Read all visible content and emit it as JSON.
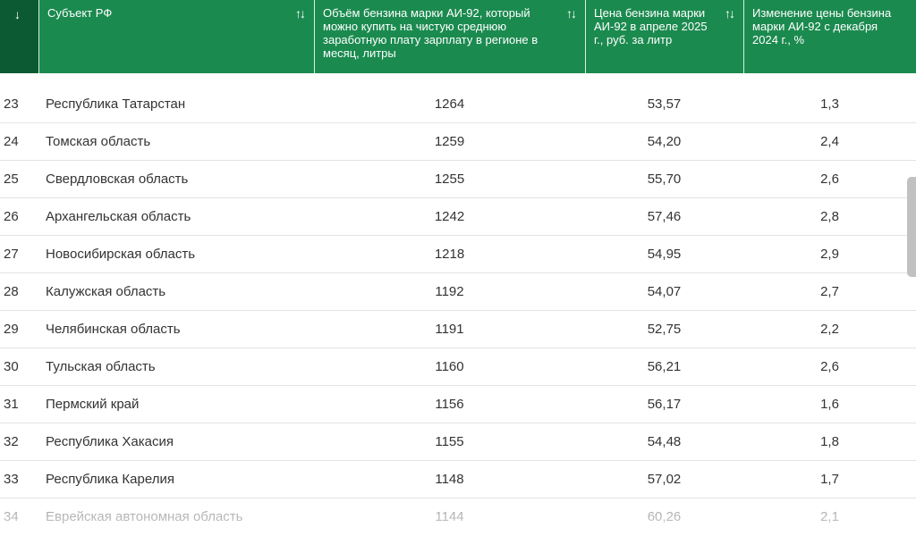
{
  "table": {
    "sort_active_icon": "↓",
    "sort_icon": "↑↓",
    "headers": [
      "Субъект РФ",
      "Объём бензина марки АИ-92, который можно купить на чистую среднюю заработную плату зарплату в регионе в месяц, литры",
      "Цена бензина марки АИ-92 в апреле 2025 г., руб. за литр",
      "Изменение цены бензина марки АИ-92 с декабря 2024 г., %"
    ],
    "rows": [
      {
        "num": "23",
        "name": "Республика Татарстан",
        "volume": "1264",
        "price": "53,57",
        "change": "1,3"
      },
      {
        "num": "24",
        "name": "Томская область",
        "volume": "1259",
        "price": "54,20",
        "change": "2,4"
      },
      {
        "num": "25",
        "name": "Свердловская область",
        "volume": "1255",
        "price": "55,70",
        "change": "2,6"
      },
      {
        "num": "26",
        "name": "Архангельская область",
        "volume": "1242",
        "price": "57,46",
        "change": "2,8"
      },
      {
        "num": "27",
        "name": "Новосибирская область",
        "volume": "1218",
        "price": "54,95",
        "change": "2,9"
      },
      {
        "num": "28",
        "name": "Калужская область",
        "volume": "1192",
        "price": "54,07",
        "change": "2,7"
      },
      {
        "num": "29",
        "name": "Челябинская область",
        "volume": "1191",
        "price": "52,75",
        "change": "2,2"
      },
      {
        "num": "30",
        "name": "Тульская область",
        "volume": "1160",
        "price": "56,21",
        "change": "2,6"
      },
      {
        "num": "31",
        "name": "Пермский край",
        "volume": "1156",
        "price": "56,17",
        "change": "1,6"
      },
      {
        "num": "32",
        "name": "Республика Хакасия",
        "volume": "1155",
        "price": "54,48",
        "change": "1,8"
      },
      {
        "num": "33",
        "name": "Республика Карелия",
        "volume": "1148",
        "price": "57,02",
        "change": "1,7"
      },
      {
        "num": "34",
        "name": "Еврейская автономная область",
        "volume": "1144",
        "price": "60,26",
        "change": "2,1"
      }
    ]
  }
}
